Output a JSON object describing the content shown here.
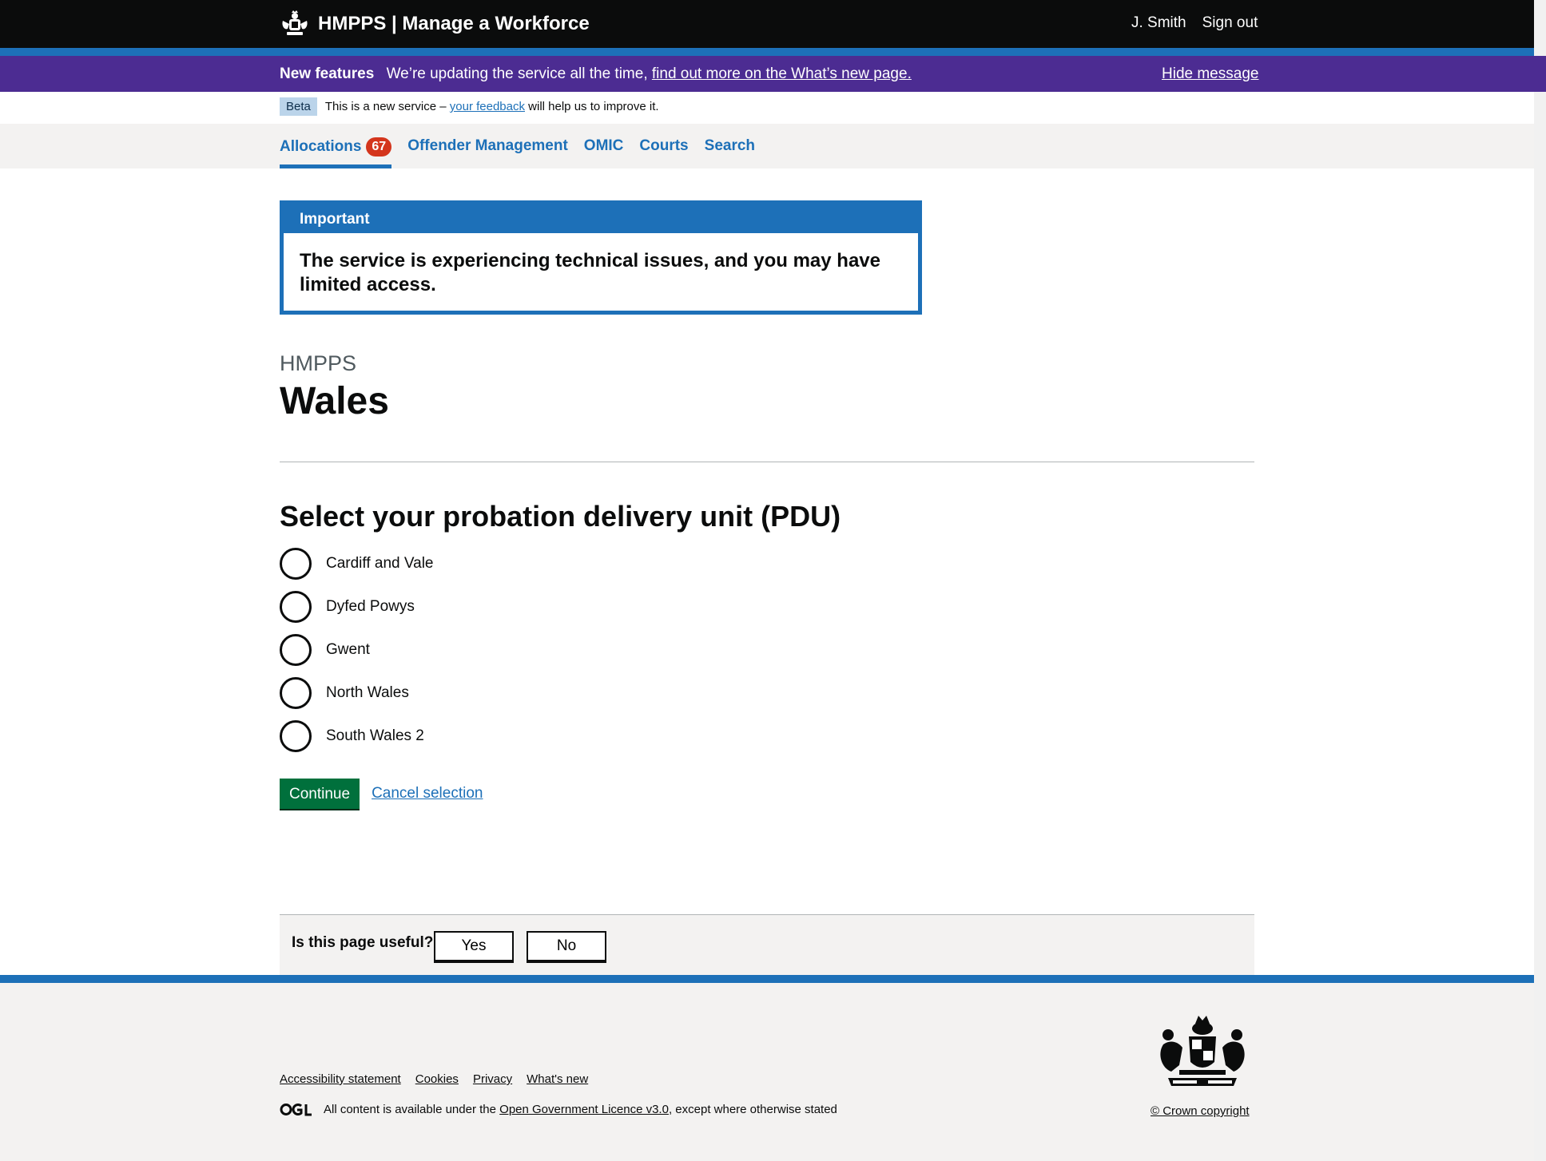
{
  "header": {
    "service_name": "HMPPS | Manage a Workforce",
    "user_name": "J. Smith",
    "sign_out": "Sign out"
  },
  "banner": {
    "label": "New features",
    "text": "We’re updating the service all the time,",
    "link": "find out more on the What’s new page.",
    "hide": "Hide message"
  },
  "phase": {
    "tag": "Beta",
    "text_before": "This is a new service –",
    "link": "your feedback",
    "text_after": "will help us to improve it."
  },
  "nav": {
    "items": [
      {
        "label": "Allocations",
        "badge": "67"
      },
      {
        "label": "Offender Management"
      },
      {
        "label": "OMIC"
      },
      {
        "label": "Courts"
      },
      {
        "label": "Search"
      }
    ]
  },
  "notice": {
    "title": "Important",
    "message": "The service is experiencing technical issues, and you may have limited access."
  },
  "page": {
    "caption": "HMPPS",
    "title": "Wales"
  },
  "form": {
    "legend": "Select your probation delivery unit (PDU)",
    "options": [
      "Cardiff and Vale",
      "Dyfed Powys",
      "Gwent",
      "North Wales",
      "South Wales 2"
    ],
    "continue": "Continue",
    "cancel": "Cancel selection"
  },
  "feedback": {
    "question": "Is this page useful?",
    "yes": "Yes",
    "no": "No"
  },
  "footer": {
    "links": [
      "Accessibility statement",
      "Cookies",
      "Privacy",
      "What's new"
    ],
    "licence_before": "All content is available under the",
    "licence_link": "Open Government Licence v3.0",
    "licence_after": ", except where otherwise stated",
    "copyright": "© Crown copyright"
  },
  "colors": {
    "header": "#0b0c0c",
    "brand_blue": "#1d70b8",
    "banner_purple": "#4c2c92",
    "button_green": "#00703c",
    "badge_red": "#d4351c"
  }
}
